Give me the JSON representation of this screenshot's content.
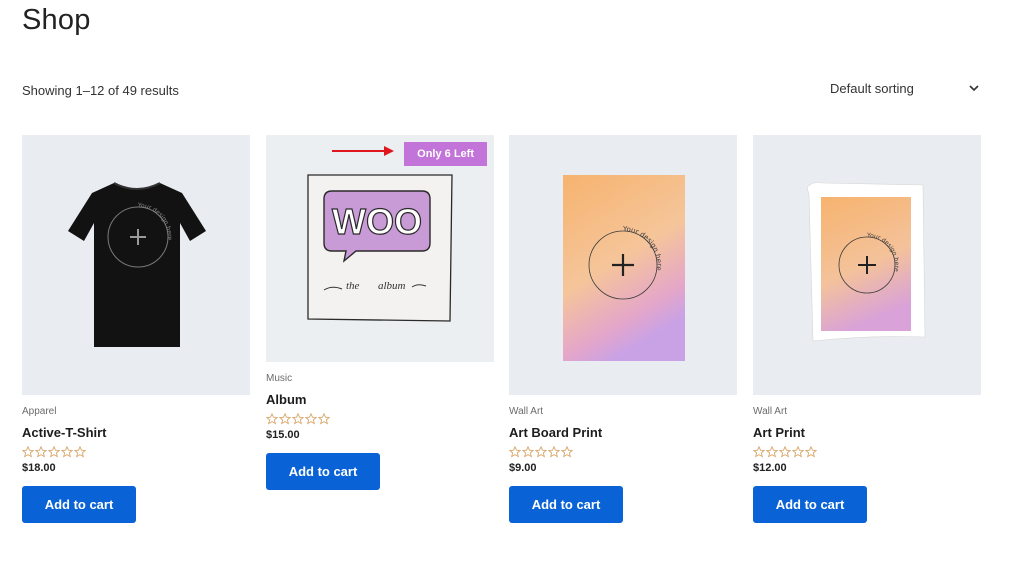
{
  "page": {
    "title": "Shop",
    "result_count": "Showing 1–12 of 49 results"
  },
  "sorting": {
    "selected": "Default sorting"
  },
  "colors": {
    "button": "#0a63d6",
    "badge": "#c374d9",
    "arrow": "#e0161e",
    "image_bg": "#e9ecf0"
  },
  "products": [
    {
      "category": "Apparel",
      "name": "Active-T-Shirt",
      "price": "$18.00",
      "button": "Add to cart",
      "rating_stars": 0
    },
    {
      "category": "Music",
      "name": "Album",
      "price": "$15.00",
      "button": "Add to cart",
      "badge": "Only 6 Left",
      "rating_stars": 0,
      "art_text": {
        "title": "WOO",
        "subtitle_1": "the",
        "subtitle_2": "album"
      }
    },
    {
      "category": "Wall Art",
      "name": "Art Board Print",
      "price": "$9.00",
      "button": "Add to cart",
      "rating_stars": 0
    },
    {
      "category": "Wall Art",
      "name": "Art Print",
      "price": "$12.00",
      "button": "Add to cart",
      "rating_stars": 0
    }
  ],
  "design_text": "Your design here"
}
